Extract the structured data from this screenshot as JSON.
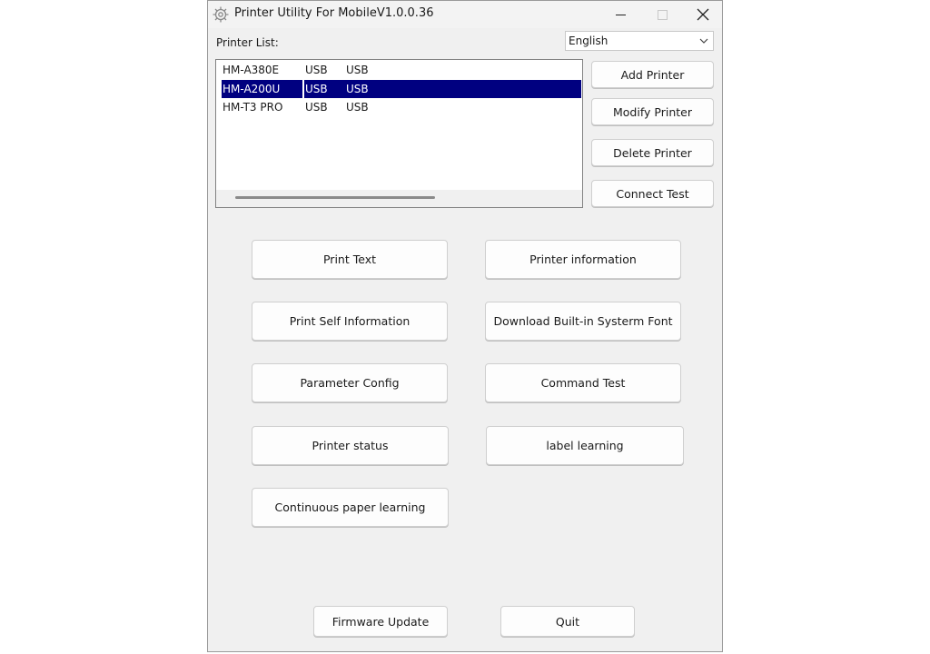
{
  "window": {
    "title": "Printer Utility For MobileV1.0.0.36",
    "icons": [
      "app-gear-icon",
      "minimize-icon",
      "maximize-icon",
      "close-icon"
    ]
  },
  "printer_list": {
    "label": "Printer List:",
    "rows": [
      {
        "name": "HM-A380E",
        "interface": "USB",
        "port": "USB",
        "selected": false
      },
      {
        "name": "HM-A200U",
        "interface": "USB",
        "port": "USB",
        "selected": true
      },
      {
        "name": "HM-T3 PRO",
        "interface": "USB",
        "port": "USB",
        "selected": false
      }
    ]
  },
  "language": {
    "selected": "English"
  },
  "side_buttons": {
    "add": "Add Printer",
    "modify": "Modify Printer",
    "delete": "Delete Printer",
    "connect_test": "Connect Test"
  },
  "actions": {
    "print_text": "Print Text",
    "printer_information": "Printer information",
    "print_self_information": "Print Self Information",
    "download_font": "Download Built-in Systerm Font",
    "parameter_config": "Parameter Config",
    "command_test": "Command Test",
    "printer_status": "Printer status",
    "label_learning": "label learning",
    "continuous_paper_learning": "Continuous paper learning"
  },
  "footer": {
    "firmware_update": "Firmware Update",
    "quit": "Quit"
  },
  "colors": {
    "selection": "#000080",
    "window_bg": "#f0f0f0"
  }
}
